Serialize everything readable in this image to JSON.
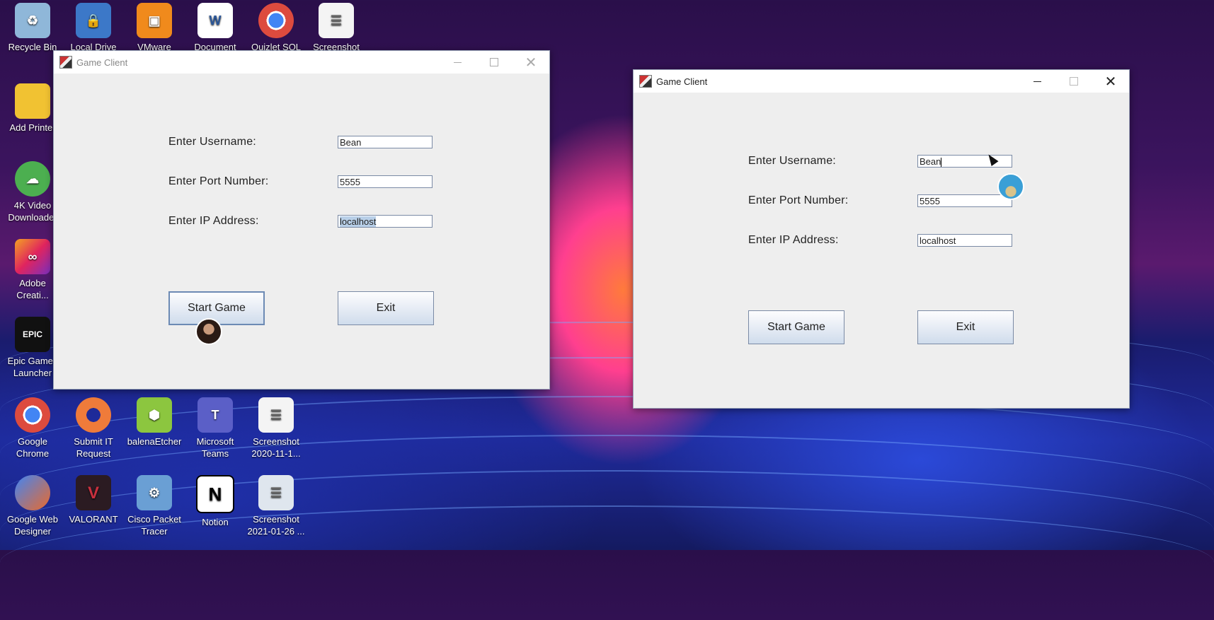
{
  "desktop": {
    "icons": [
      {
        "label": "Recycle Bin",
        "icon": "recycle-bin-icon",
        "color": "#8fb7d9"
      },
      {
        "label": "Local Drive",
        "icon": "lock-drive-icon",
        "color": "#3c78c8"
      },
      {
        "label": "VMware",
        "icon": "vmware-icon",
        "color": "#f08a1c"
      },
      {
        "label": "Document",
        "icon": "word-document-icon",
        "color": "#ffffff"
      },
      {
        "label": "Quizlet SQL",
        "icon": "chrome-icon",
        "color": "#dd4b3e"
      },
      {
        "label": "Screenshot",
        "icon": "screenshot-file-icon",
        "color": "#f4f4f4"
      },
      {
        "label": "Add Printer",
        "icon": "folder-icon",
        "color": "#f1c232"
      },
      {
        "label": "4K Video\nDownloader",
        "icon": "download-cloud-icon",
        "color": "#4caf50"
      },
      {
        "label": "Adobe\nCreati...",
        "icon": "adobe-creative-cloud-icon",
        "color": "#e0245e"
      },
      {
        "label": "Epic Games\nLauncher",
        "icon": "epic-games-icon",
        "color": "#111111"
      },
      {
        "label": "Google\nChrome",
        "icon": "chrome-icon",
        "color": "#dd4b3e"
      },
      {
        "label": "Submit IT\nRequest",
        "icon": "lifebuoy-icon",
        "color": "#ef7b3a"
      },
      {
        "label": "balenaEtcher",
        "icon": "balena-cube-icon",
        "color": "#8cc63f"
      },
      {
        "label": "Microsoft\nTeams",
        "icon": "teams-icon",
        "color": "#5b5fc7"
      },
      {
        "label": "Screenshot\n2020-11-1...",
        "icon": "screenshot-file-icon",
        "color": "#f4f4f4"
      },
      {
        "label": "Google Web\nDesigner",
        "icon": "web-designer-icon",
        "color": "#ea6a2c"
      },
      {
        "label": "VALORANT",
        "icon": "valorant-icon",
        "color": "#c9303e"
      },
      {
        "label": "Cisco Packet\nTracer",
        "icon": "packet-tracer-icon",
        "color": "#6a9fd4"
      },
      {
        "label": "Notion",
        "icon": "notion-icon",
        "color": "#ffffff"
      },
      {
        "label": "Screenshot\n2021-01-26 ...",
        "icon": "screenshot-file-icon",
        "color": "#dfe6ee"
      }
    ]
  },
  "window_left": {
    "title": "Game Client",
    "username_label": "Enter Username:",
    "username_value": "Bean",
    "port_label": "Enter Port Number:",
    "port_value": "5555",
    "ip_label": "Enter IP Address:",
    "ip_value": "localhost",
    "start_label": "Start Game",
    "exit_label": "Exit"
  },
  "window_right": {
    "title": "Game Client",
    "username_label": "Enter Username:",
    "username_value": "Bean",
    "port_label": "Enter Port Number:",
    "port_value": "5555",
    "ip_label": "Enter IP Address:",
    "ip_value": "localhost",
    "start_label": "Start Game",
    "exit_label": "Exit"
  }
}
